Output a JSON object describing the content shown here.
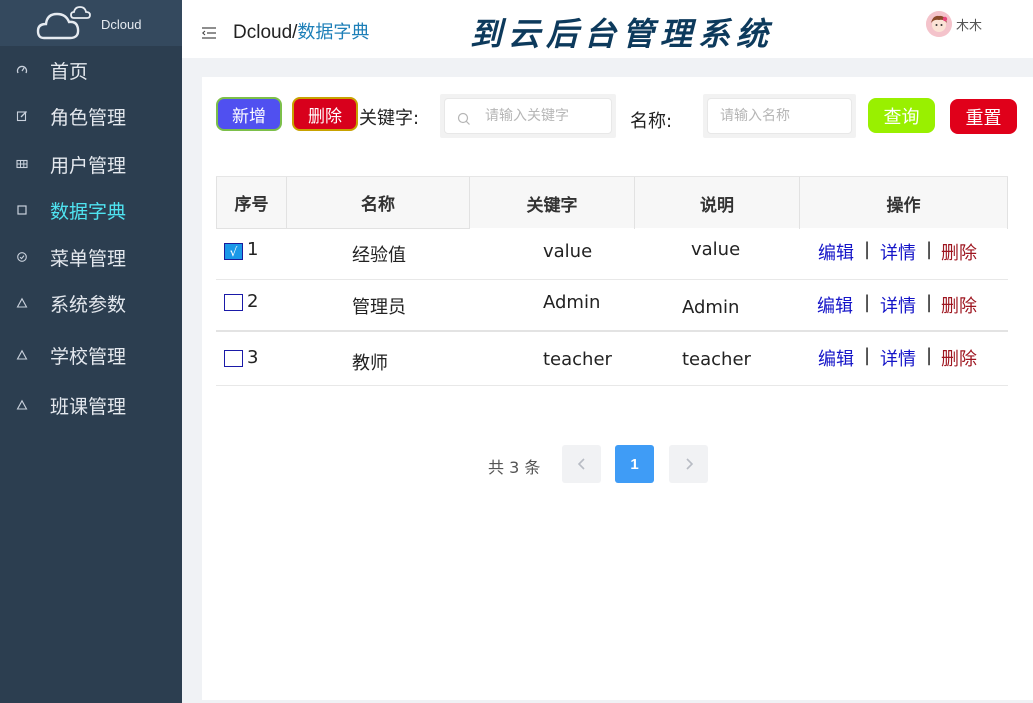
{
  "brand": {
    "logo_text": "Dcloud"
  },
  "sidebar": {
    "items": [
      {
        "label": "首页",
        "icon": "dashboard-icon",
        "active": false
      },
      {
        "label": "角色管理",
        "icon": "edit-icon",
        "active": false
      },
      {
        "label": "用户管理",
        "icon": "grid-icon",
        "active": false
      },
      {
        "label": "数据字典",
        "icon": "square-icon",
        "active": true
      },
      {
        "label": "菜单管理",
        "icon": "circle-check-icon",
        "active": false
      },
      {
        "label": "系统参数",
        "icon": "triangle-icon",
        "active": false
      },
      {
        "label": "学校管理",
        "icon": "triangle-icon",
        "active": false
      },
      {
        "label": "班课管理",
        "icon": "triangle-icon",
        "active": false
      }
    ]
  },
  "header": {
    "breadcrumb_root": "Dcloud/",
    "breadcrumb_current": "数据字典",
    "system_title": "到云后台管理系统",
    "user_name": "木木"
  },
  "toolbar": {
    "add_label": "新增",
    "delete_label": "删除",
    "keyword_label": "关键字:",
    "keyword_placeholder": "请输入关键字",
    "keyword_value": "",
    "name_label": "名称:",
    "name_placeholder": "请输入名称",
    "name_value": "",
    "query_label": "查询",
    "reset_label": "重置"
  },
  "table": {
    "headers": [
      "序号",
      "名称",
      "关键字",
      "说明",
      "操作"
    ],
    "rows": [
      {
        "index": "1",
        "name": "经验值",
        "keyword": "value",
        "description": "value",
        "checked": true
      },
      {
        "index": "2",
        "name": "管理员",
        "keyword": "Admin",
        "description": "Admin",
        "checked": false
      },
      {
        "index": "3",
        "name": "教师",
        "keyword": "teacher",
        "description": "teacher",
        "checked": false
      }
    ],
    "actions": {
      "edit": "编辑",
      "detail": "详情",
      "remove": "删除",
      "separator": "|"
    },
    "check_mark": "√"
  },
  "pagination": {
    "total_text": "共 3 条",
    "current_page": "1"
  },
  "colors": {
    "sidebar_bg": "#2c3e50",
    "active_menu": "#4fe3f0",
    "add_button": "#5050f0",
    "delete_button": "#d8001c",
    "query_button": "#99f000",
    "reset_button": "#e0001a",
    "page_active": "#3f9cf6"
  }
}
